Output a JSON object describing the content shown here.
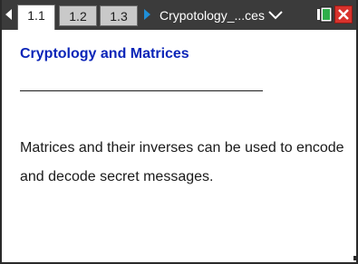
{
  "tabs": [
    {
      "label": "1.1",
      "active": true
    },
    {
      "label": "1.2",
      "active": false
    },
    {
      "label": "1.3",
      "active": false
    }
  ],
  "document": {
    "title": "Crypotology_...ces"
  },
  "icons": {
    "previous_page": "triangle-left-icon",
    "next_page": "triangle-right-icon",
    "document_menu": "chevron-down-icon",
    "battery": "battery-icon",
    "close": "close-icon"
  },
  "colors": {
    "tabbar_background": "#3b3b3b",
    "active_tab": "#ffffff",
    "inactive_tab": "#c9c9c9",
    "next_arrow": "#1f8fd8",
    "title_text": "#0b25b8",
    "close_button": "#d8322c",
    "battery_fill": "#2fae4a"
  },
  "content": {
    "heading": "Cryptology and Matrices",
    "paragraph": "Matrices and their inverses can be used to encode and decode secret messages."
  }
}
